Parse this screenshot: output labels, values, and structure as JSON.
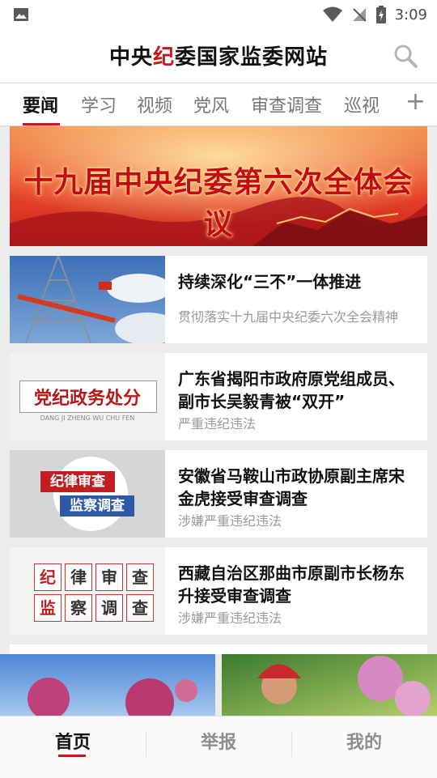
{
  "status": {
    "time": "3:09"
  },
  "app": {
    "title_part1": "中央",
    "title_part2": "纪",
    "title_part3": "委国家监委网站"
  },
  "tabs": [
    {
      "label": "要闻",
      "active": true
    },
    {
      "label": "学习"
    },
    {
      "label": "视频"
    },
    {
      "label": "党风"
    },
    {
      "label": "审查调查"
    },
    {
      "label": "巡视"
    }
  ],
  "banner": {
    "text": "十九届中央纪委第六次全体会议"
  },
  "articles": [
    {
      "title": "持续深化“三不”一体推进",
      "subtitle": "贯彻落实十九届中央纪委六次全会精神"
    },
    {
      "title": "广东省揭阳市政府原党组成员、副市长吴毅青被“双开”",
      "subtitle": "严重违纪违法",
      "thumb_text": "党纪政务处分",
      "thumb_pinyin": "DANG JI ZHENG WU CHU FEN"
    },
    {
      "title": "安徽省马鞍山市政协原副主席宋金虎接受审查调查",
      "subtitle": "涉嫌严重违纪违法",
      "thumb_line1": "纪律审查",
      "thumb_line2": "监察调查"
    },
    {
      "title": "西藏自治区那曲市原副市长杨东升接受审查调查",
      "subtitle": "涉嫌严重违纪违法",
      "thumb_chars": [
        "纪",
        "律",
        "审",
        "查",
        "监",
        "察",
        "调",
        "查"
      ]
    }
  ],
  "bottom_nav": [
    {
      "label": "首页",
      "active": true
    },
    {
      "label": "举报"
    },
    {
      "label": "我的"
    }
  ],
  "colors": {
    "accent": "#c8161e",
    "background": "#ececec"
  }
}
